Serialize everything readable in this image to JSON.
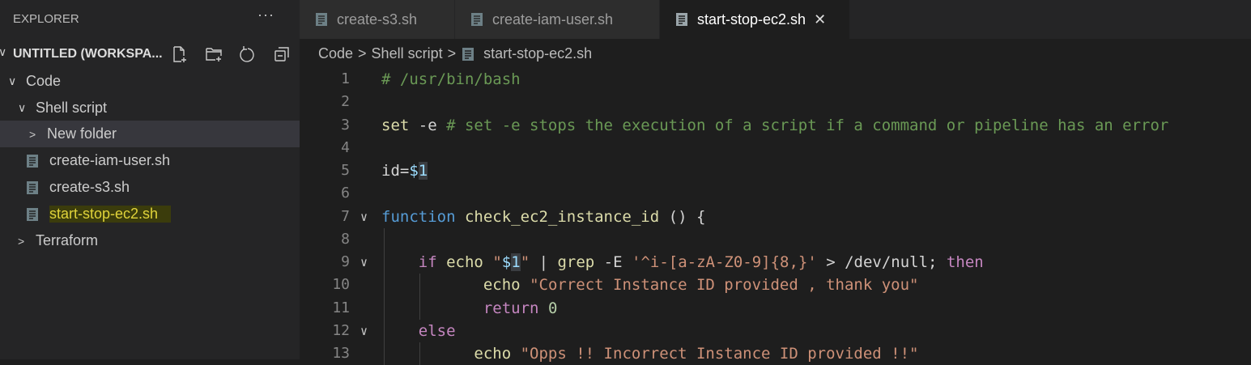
{
  "sidebar": {
    "title": "EXPLORER",
    "more": "···",
    "workspace": "UNTITLED (WORKSPA...",
    "tree": [
      {
        "label": "Code",
        "type": "folder",
        "expanded": true
      },
      {
        "label": "Shell script",
        "type": "folder",
        "expanded": true
      },
      {
        "label": "New folder",
        "type": "folder",
        "expanded": false,
        "selected": true
      },
      {
        "label": "create-iam-user.sh",
        "type": "file"
      },
      {
        "label": "create-s3.sh",
        "type": "file"
      },
      {
        "label": "start-stop-ec2.sh",
        "type": "file",
        "highlighted": true
      },
      {
        "label": "Terraform",
        "type": "folder",
        "expanded": false
      }
    ]
  },
  "tabs": [
    {
      "label": "create-s3.sh",
      "active": false
    },
    {
      "label": "create-iam-user.sh",
      "active": false
    },
    {
      "label": "start-stop-ec2.sh",
      "active": true
    }
  ],
  "breadcrumb": [
    "Code",
    "Shell script",
    "start-stop-ec2.sh"
  ],
  "code": [
    {
      "n": "1",
      "t": [
        [
          "cm",
          "# /usr/bin/bash"
        ]
      ]
    },
    {
      "n": "2",
      "t": []
    },
    {
      "n": "3",
      "t": [
        [
          "bi",
          "set"
        ],
        [
          "pl",
          " -e "
        ],
        [
          "cm",
          "# set -e stops the execution of a script if a command or pipeline has an error"
        ]
      ]
    },
    {
      "n": "4",
      "t": []
    },
    {
      "n": "5",
      "t": [
        [
          "pl",
          "id="
        ],
        [
          "var",
          "$"
        ],
        [
          "varhl",
          "1"
        ]
      ]
    },
    {
      "n": "6",
      "t": []
    },
    {
      "n": "7",
      "fold": true,
      "t": [
        [
          "fn",
          "function"
        ],
        [
          "pl",
          " "
        ],
        [
          "bi",
          "check_ec2_instance_id"
        ],
        [
          "pl",
          " () {"
        ]
      ]
    },
    {
      "n": "8",
      "t": []
    },
    {
      "n": "9",
      "fold": true,
      "t": [
        [
          "pl",
          "    "
        ],
        [
          "kw",
          "if"
        ],
        [
          "pl",
          " "
        ],
        [
          "bi",
          "echo"
        ],
        [
          "pl",
          " "
        ],
        [
          "str",
          "\""
        ],
        [
          "var",
          "$"
        ],
        [
          "varhl",
          "1"
        ],
        [
          "str",
          "\""
        ],
        [
          "pl",
          " | "
        ],
        [
          "bi",
          "grep"
        ],
        [
          "pl",
          " -E "
        ],
        [
          "str",
          "'^i-[a-zA-Z0-9]{8,}'"
        ],
        [
          "pl",
          " > /dev/null; "
        ],
        [
          "kw",
          "then"
        ]
      ]
    },
    {
      "n": "10",
      "t": [
        [
          "pl",
          "           "
        ],
        [
          "bi",
          "echo"
        ],
        [
          "pl",
          " "
        ],
        [
          "str",
          "\"Correct Instance ID provided , thank you\""
        ]
      ]
    },
    {
      "n": "11",
      "t": [
        [
          "pl",
          "           "
        ],
        [
          "kw",
          "return"
        ],
        [
          "pl",
          " "
        ],
        [
          "num",
          "0"
        ]
      ]
    },
    {
      "n": "12",
      "fold": true,
      "t": [
        [
          "pl",
          "    "
        ],
        [
          "kw",
          "else"
        ]
      ]
    },
    {
      "n": "13",
      "t": [
        [
          "pl",
          "          "
        ],
        [
          "bi",
          "echo"
        ],
        [
          "pl",
          " "
        ],
        [
          "str",
          "\"Opps !! Incorrect Instance ID provided !!\""
        ]
      ]
    }
  ]
}
